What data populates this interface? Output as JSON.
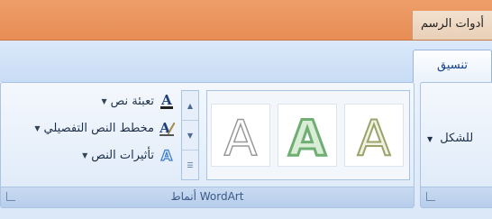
{
  "contextual_tab_group": {
    "title": "أدوات الرسم"
  },
  "tabs": {
    "active_label": "تنسيق"
  },
  "wordart_group": {
    "label": "أنماط WordArt",
    "commands": [
      {
        "label": "تعبئة نص",
        "icon": "text-fill-icon"
      },
      {
        "label": "مخطط النص التفصيلي",
        "icon": "text-outline-icon"
      },
      {
        "label": "تأثيرات النص",
        "icon": "text-effects-icon"
      }
    ],
    "styles": [
      {
        "letter": "A",
        "icon": "wordart-style-1-icon"
      },
      {
        "letter": "A",
        "icon": "wordart-style-2-icon"
      },
      {
        "letter": "A",
        "icon": "wordart-style-3-icon"
      }
    ],
    "colors": {
      "text_fill_underline": "#222222",
      "style1_stroke": "#9a9a9a",
      "style2_stroke": "#6fae72",
      "style3_stroke": "#9aa36a"
    }
  },
  "shape_group": {
    "command_label": "للشكل"
  }
}
